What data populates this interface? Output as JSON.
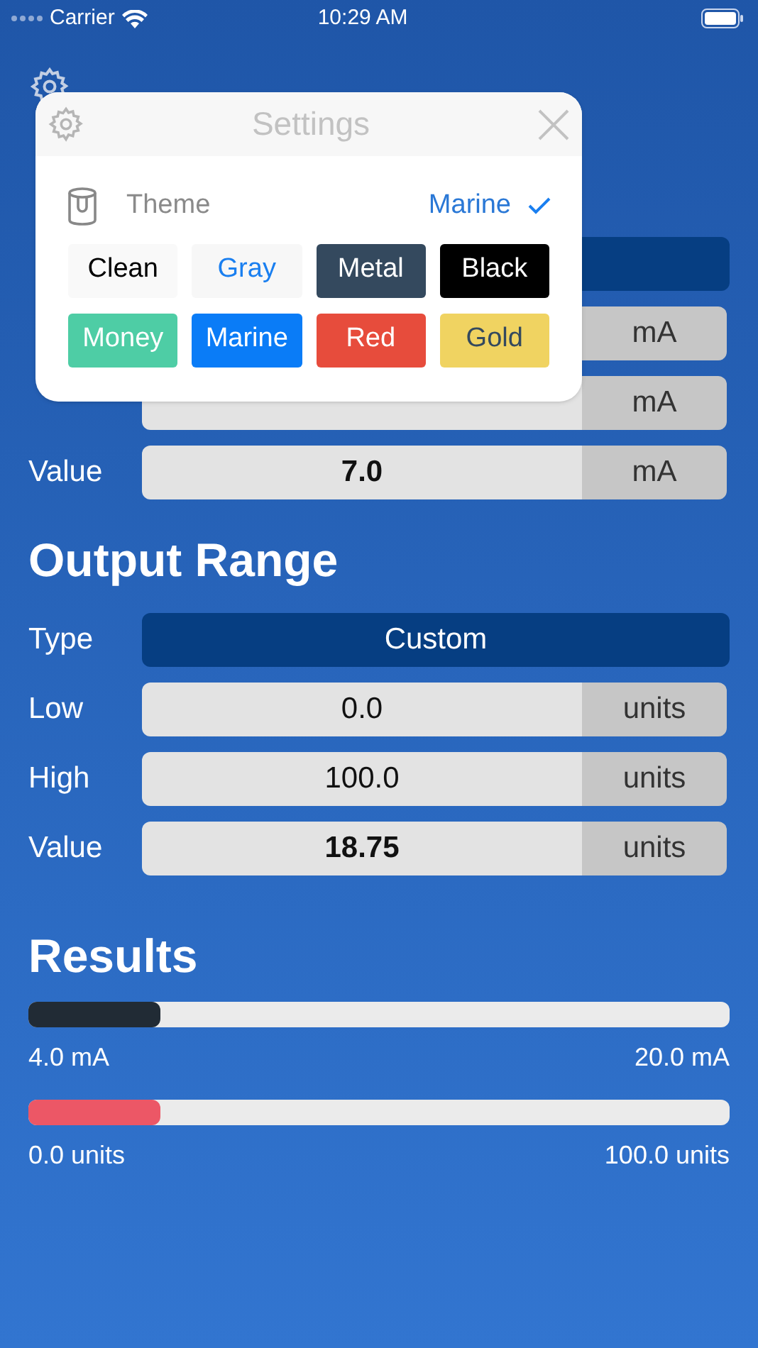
{
  "status_bar": {
    "carrier": "Carrier",
    "time": "10:29 AM"
  },
  "input_range": {
    "type_row": {
      "selected": true
    },
    "rows": [
      {
        "unit": "mA"
      },
      {
        "unit": "mA"
      },
      {
        "label": "Value",
        "value": "7.0",
        "unit": "mA",
        "bold": true
      }
    ]
  },
  "output_range": {
    "title": "Output Range",
    "type_label": "Type",
    "type_value": "Custom",
    "rows": [
      {
        "label": "Low",
        "value": "0.0",
        "unit": "units",
        "bold": false
      },
      {
        "label": "High",
        "value": "100.0",
        "unit": "units",
        "bold": false
      },
      {
        "label": "Value",
        "value": "18.75",
        "unit": "units",
        "bold": true
      }
    ]
  },
  "results": {
    "title": "Results",
    "bars": [
      {
        "level": 0.1875,
        "color": "#212b35",
        "min": "4.0 mA",
        "max": "20.0 mA"
      },
      {
        "level": 0.1875,
        "color": "#ec5766",
        "min": "0.0 units",
        "max": "100.0 units"
      }
    ]
  },
  "settings": {
    "title": "Settings",
    "theme_label": "Theme",
    "theme_value": "Marine",
    "themes": [
      {
        "name": "Clean",
        "color": "#f9f9f9"
      },
      {
        "name": "Gray",
        "color": "#f7f7f7"
      },
      {
        "name": "Metal",
        "color": "#34495e"
      },
      {
        "name": "Black",
        "color": "#000000"
      },
      {
        "name": "Money",
        "color": "#4ecda5"
      },
      {
        "name": "Marine",
        "color": "#0a7cf7"
      },
      {
        "name": "Red",
        "color": "#e74c3c"
      },
      {
        "name": "Gold",
        "color": "#f0d361"
      }
    ]
  }
}
